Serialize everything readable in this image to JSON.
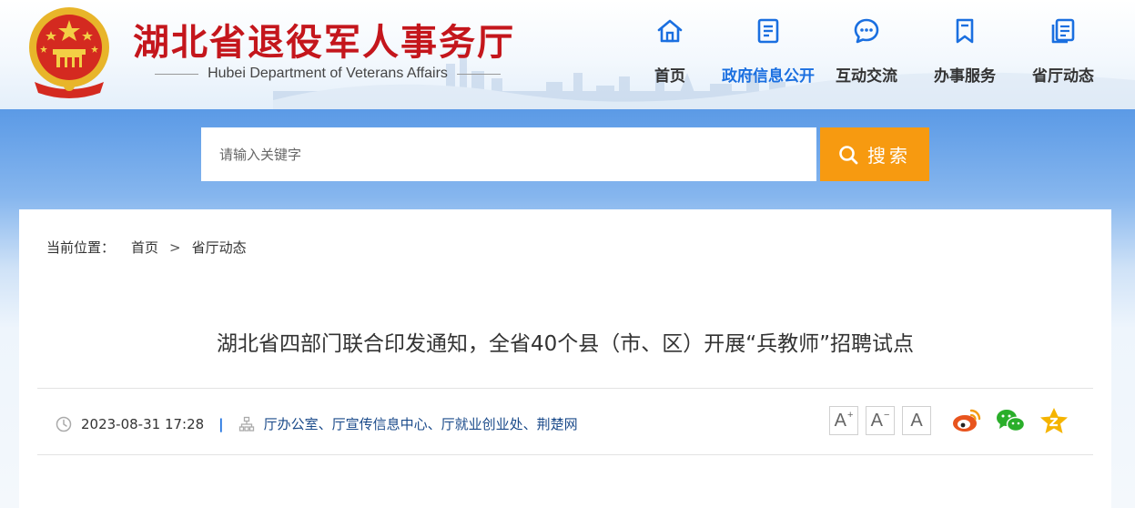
{
  "header": {
    "site_title": "湖北省退役军人事务厅",
    "site_subtitle": "Hubei Department of Veterans Affairs",
    "brand_color": "#c4161c"
  },
  "nav": {
    "items": [
      {
        "label": "首页",
        "icon": "home-icon"
      },
      {
        "label": "政府信息公开",
        "icon": "document-list-icon",
        "active": true
      },
      {
        "label": "互动交流",
        "icon": "chat-bubble-icon"
      },
      {
        "label": "办事服务",
        "icon": "bookmark-icon"
      },
      {
        "label": "省厅动态",
        "icon": "news-pages-icon"
      }
    ],
    "active_color": "#1a6fe0"
  },
  "search": {
    "placeholder": "请输入关键字",
    "button_label": "搜索",
    "button_color": "#f79a10"
  },
  "breadcrumb": {
    "prefix": "当前位置：",
    "items": [
      "首页",
      "省厅动态"
    ],
    "separator": ">"
  },
  "article": {
    "title": "湖北省四部门联合印发通知，全省40个县（市、区）开展“兵教师”招聘试点",
    "datetime": "2023-08-31 17:28",
    "sources": "厅办公室、厅宣传信息中心、厅就业创业处、荆楚网"
  },
  "tools": {
    "font_increase": "A",
    "font_decrease": "A",
    "font_default": "A",
    "share_icons": [
      "weibo-icon",
      "wechat-icon",
      "favorite-star-icon"
    ]
  }
}
